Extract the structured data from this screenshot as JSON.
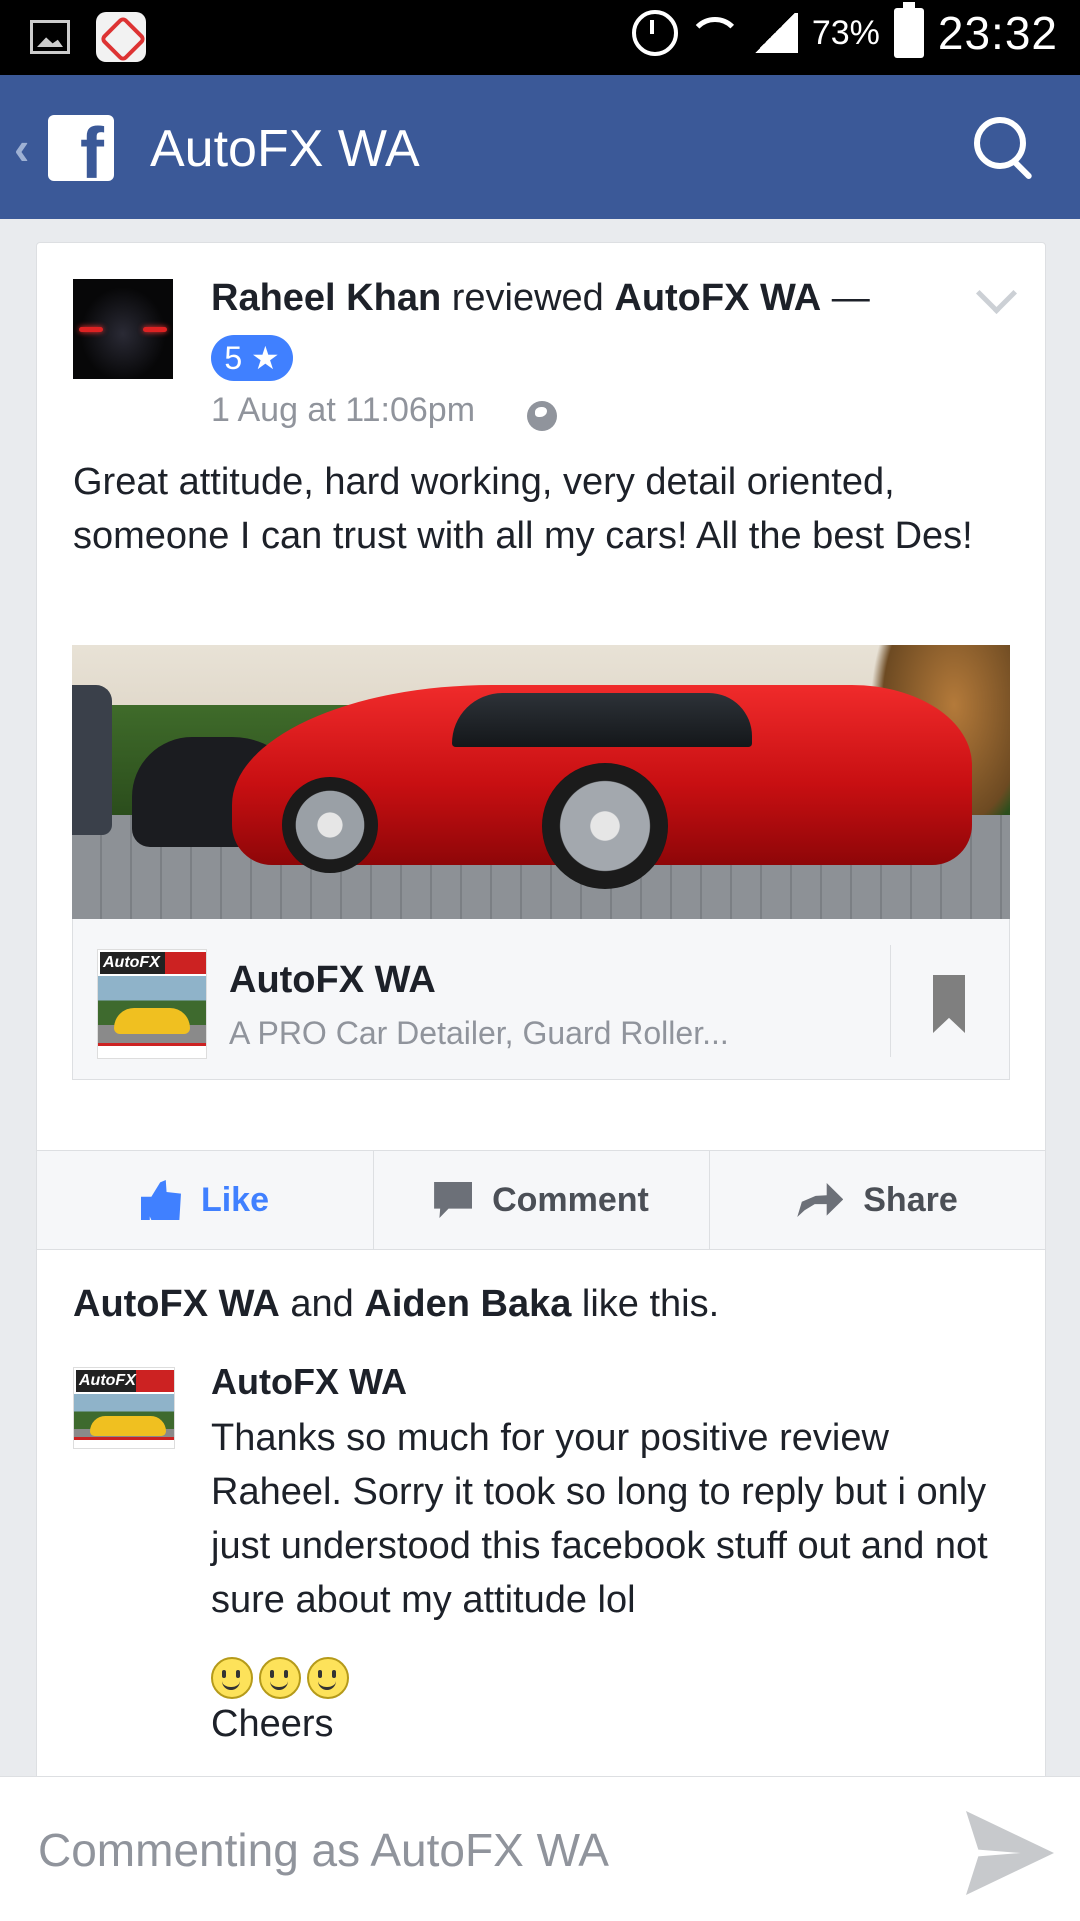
{
  "status_bar": {
    "battery": "73%",
    "time": "23:32"
  },
  "app_bar": {
    "logo": "f",
    "title": "AutoFX WA"
  },
  "post": {
    "author": "Raheel Khan",
    "action": " reviewed ",
    "page": "AutoFX WA",
    "dash": " —",
    "rating": "5 ★",
    "time": "1 Aug at 11:06pm",
    "text": "Great attitude, hard working, very detail oriented, someone I can trust with all my cars! All the best Des!",
    "link": {
      "brand": "AutoFX",
      "title": "AutoFX WA",
      "subtitle": "A PRO Car Detailer, Guard Roller..."
    }
  },
  "actions": {
    "like": "Like",
    "comment": "Comment",
    "share": "Share"
  },
  "likes": {
    "name1": "AutoFX WA",
    "and": " and ",
    "name2": "Aiden Baka",
    "suffix": " like this."
  },
  "comment": {
    "author": "AutoFX WA",
    "brand": "AutoFX",
    "text": "Thanks so much for your positive review Raheel.  Sorry it took so long to reply but i only just understood this facebook stuff out and not sure about my attitude lol",
    "signoff": "Cheers"
  },
  "composer": {
    "placeholder": "Commenting as AutoFX WA"
  },
  "icons": [
    "image-icon",
    "app-icon",
    "alarm-icon",
    "wifi-icon",
    "signal-icon",
    "battery-icon",
    "back-chevron-icon",
    "facebook-logo-icon",
    "search-icon",
    "dropdown-chevron-icon",
    "globe-icon",
    "bookmark-icon",
    "like-icon",
    "comment-icon",
    "share-icon",
    "smiley-icon",
    "send-icon"
  ],
  "colors": {
    "facebook_blue": "#3b5998",
    "like_blue": "#4080ff",
    "background": "#e9ebee"
  }
}
